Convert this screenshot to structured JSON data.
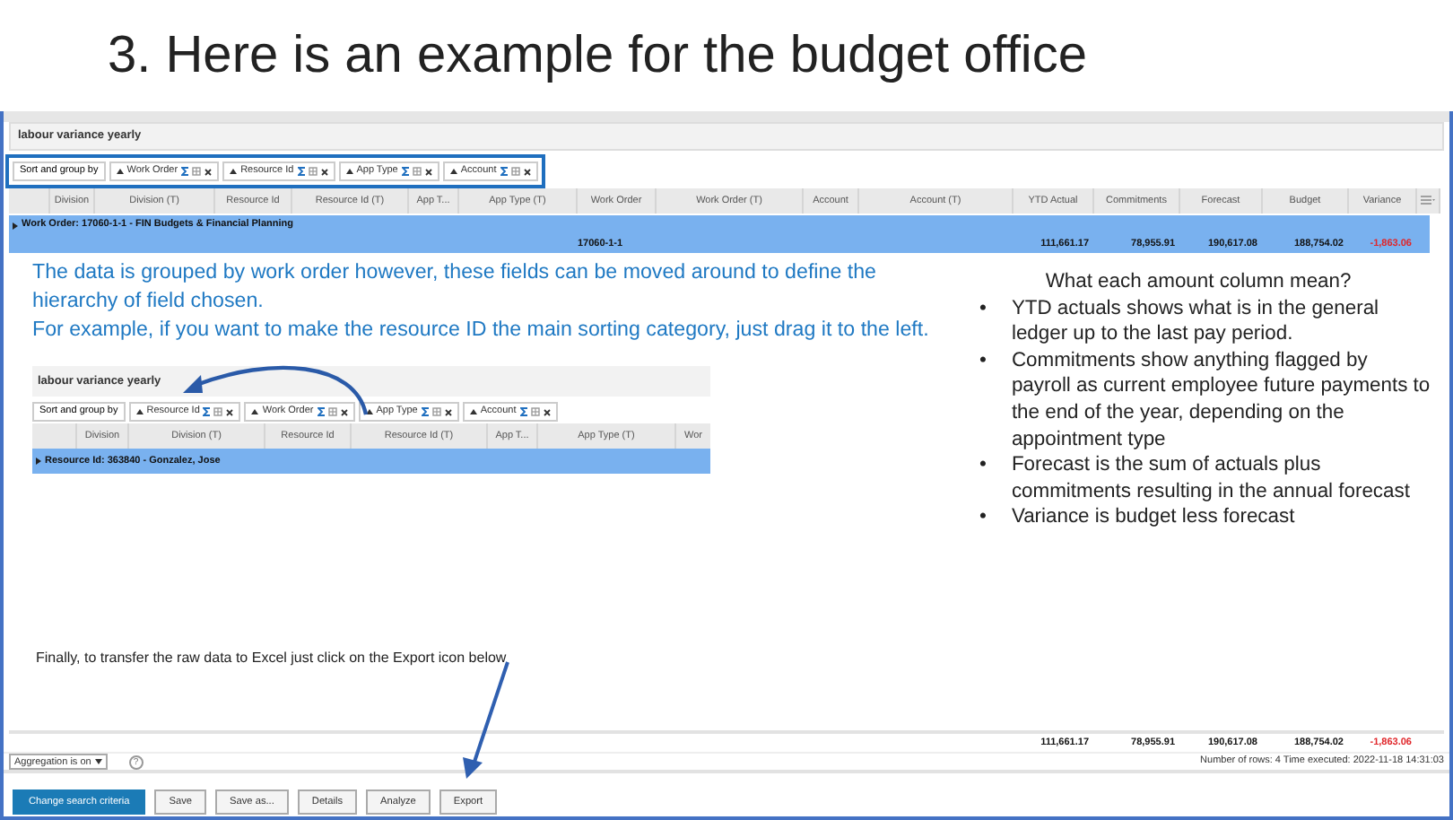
{
  "slide_title": "3. Here is an example for the budget office",
  "report": {
    "title": "labour variance yearly",
    "sort_label": "Sort and group by",
    "sort_fields": [
      {
        "label": "Work Order"
      },
      {
        "label": "Resource Id"
      },
      {
        "label": "App Type"
      },
      {
        "label": "Account"
      }
    ],
    "group_label": "Work Order: 17060-1-1 - FIN Budgets & Financial Planning",
    "columns": [
      {
        "label": "Division"
      },
      {
        "label": "Division (T)"
      },
      {
        "label": "Resource Id"
      },
      {
        "label": "Resource Id (T)"
      },
      {
        "label": "App T..."
      },
      {
        "label": "App Type (T)"
      },
      {
        "label": "Work Order",
        "group_value": "17060-1-1",
        "negative": false
      },
      {
        "label": "Work Order (T)"
      },
      {
        "label": "Account"
      },
      {
        "label": "Account (T)"
      },
      {
        "label": "YTD Actual",
        "group_value": "111,661.17",
        "total": "111,661.17",
        "negative": false
      },
      {
        "label": "Commitments",
        "group_value": "78,955.91",
        "total": "78,955.91",
        "negative": false
      },
      {
        "label": "Forecast",
        "group_value": "190,617.08",
        "total": "190,617.08",
        "negative": false
      },
      {
        "label": "Budget",
        "group_value": "188,754.02",
        "total": "188,754.02",
        "negative": false
      },
      {
        "label": "Variance",
        "group_value": "-1,863.06",
        "total": "-1,863.06",
        "negative": true
      }
    ],
    "aggregation": "Aggregation is on",
    "help": "?",
    "status": "Number of rows: 4  Time executed: 2022-11-18 14:31:03",
    "buttons": [
      {
        "label": "Change search criteria",
        "primary": true
      },
      {
        "label": "Save",
        "primary": false
      },
      {
        "label": "Save as...",
        "primary": false
      },
      {
        "label": "Details",
        "primary": false
      },
      {
        "label": "Analyze",
        "primary": false
      },
      {
        "label": "Export",
        "primary": false
      }
    ]
  },
  "explanation": {
    "paragraphs": [
      "The data is grouped by work order however, these fields can be moved around to define the hierarchy of field chosen.",
      "For example, if you want to make the resource ID the main sorting category, just drag it to the left."
    ],
    "inset": {
      "title": "labour variance yearly",
      "sort_label": "Sort and group by",
      "sort_fields": [
        {
          "label": "Resource Id"
        },
        {
          "label": "Work Order"
        },
        {
          "label": "App Type"
        },
        {
          "label": "Account"
        }
      ],
      "columns": [
        "Division",
        "Division (T)",
        "Resource Id",
        "Resource Id (T)",
        "App T...",
        "App Type (T)",
        "Wor"
      ],
      "group_label": "Resource Id: 363840 - Gonzalez, Jose"
    },
    "aside_title": "What each amount column mean?",
    "bullet_marker": "•",
    "bullets": [
      "YTD actuals shows what is in the general ledger up to the last pay period.",
      "Commitments show anything flagged by payroll as current employee future payments to the end of the year, depending on the appointment type",
      "Forecast is the sum of actuals plus commitments resulting in the annual forecast",
      "Variance is budget less forecast"
    ],
    "footer_note": "Finally, to transfer the raw data to Excel just click on the Export icon below"
  }
}
